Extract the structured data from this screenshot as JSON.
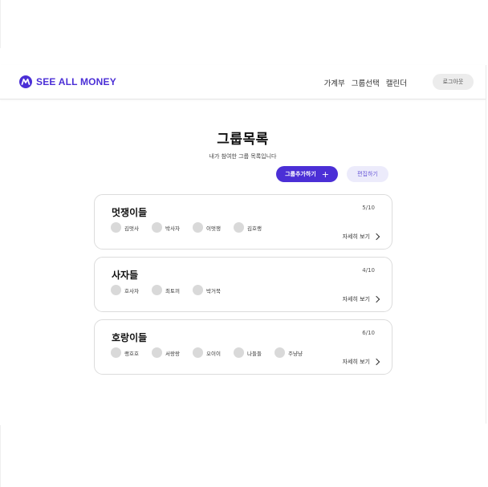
{
  "header": {
    "logo_text": "SEE ALL MONEY",
    "nav": [
      "가계부",
      "그룹선택",
      "캘린더"
    ],
    "logout_label": "로그아웃",
    "brand_color": "#4b2fd6"
  },
  "page": {
    "title": "그룹목록",
    "subtitle": "내가 참여한 그룹 목록입니다"
  },
  "actions": {
    "add_group_label": "그룹추가하기",
    "add_icon": "+",
    "edit_label": "편집하기"
  },
  "groups": [
    {
      "name": "멋쟁이들",
      "count": "5/10",
      "members": [
        "김멋사",
        "박사자",
        "이멋쟁",
        "김호랭"
      ],
      "detail_label": "자세히 보기"
    },
    {
      "name": "사자들",
      "count": "4/10",
      "members": [
        "호사자",
        "최토끼",
        "박거북"
      ],
      "detail_label": "자세히 보기"
    },
    {
      "name": "호랑이들",
      "count": "6/10",
      "members": [
        "랭호호",
        "서랑랑",
        "오이이",
        "나들들",
        "주냥냥"
      ],
      "detail_label": "자세히 보기"
    }
  ]
}
